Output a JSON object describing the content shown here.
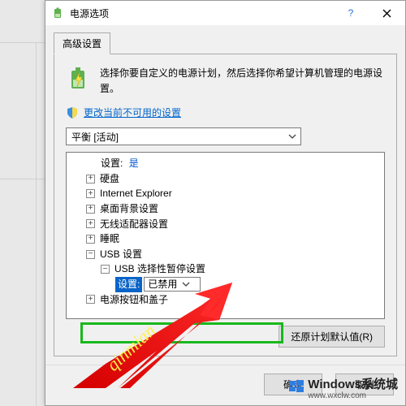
{
  "window": {
    "title": "电源选项"
  },
  "tabs": {
    "advanced": "高级设置"
  },
  "intro": {
    "desc": "选择你要自定义的电源计划，然后选择你希望计算机管理的电源设置。"
  },
  "link": {
    "change_unavailable": "更改当前不可用的设置"
  },
  "plan_combo": {
    "value": "平衡 [活动]"
  },
  "tree": {
    "setting_label": "设置:",
    "setting_value": "是",
    "hard_disk": "硬盘",
    "ie": "Internet Explorer",
    "desktop_bg": "桌面背景设置",
    "wireless": "无线适配器设置",
    "sleep": "睡眠",
    "usb": "USB 设置",
    "usb_suspend": "USB 选择性暂停设置",
    "inline_setting_label": "设置:",
    "inline_setting_value": "已禁用",
    "power_buttons": "电源按钮和盖子"
  },
  "buttons": {
    "restore": "还原计划默认值(R)",
    "ok": "确定",
    "cancel": "取消"
  },
  "watermark": {
    "brand": "Windows系统城",
    "url": "www.wxclw.com",
    "annotation": "qinmian"
  }
}
